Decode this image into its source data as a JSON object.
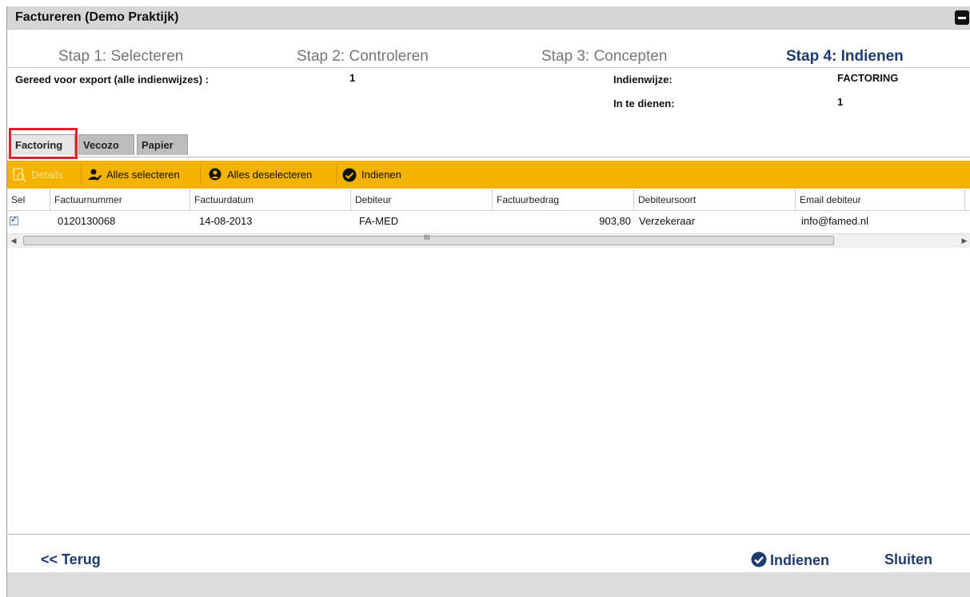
{
  "window": {
    "title": "Factureren (Demo Praktijk)",
    "minimize_icon": "minimize-icon"
  },
  "steps": [
    {
      "label": "Stap 1: Selecteren",
      "active": false
    },
    {
      "label": "Stap 2: Controleren",
      "active": false
    },
    {
      "label": "Stap 3: Concepten",
      "active": false
    },
    {
      "label": "Stap 4: Indienen",
      "active": true
    }
  ],
  "info": {
    "ready_label": "Gereed voor export (alle indienwijzes) :",
    "ready_value": "1",
    "method_label": "Indienwijze:",
    "method_value": "FACTORING",
    "to_submit_label": "In te dienen:",
    "to_submit_value": "1"
  },
  "tabs": [
    {
      "label": "Factoring",
      "active": true
    },
    {
      "label": "Vecozo",
      "active": false
    },
    {
      "label": "Papier",
      "active": false
    }
  ],
  "toolbar": {
    "details_label": "Details",
    "select_all_label": "Alles selecteren",
    "deselect_all_label": "Alles deselecteren",
    "submit_label": "Indienen"
  },
  "table": {
    "columns": [
      "Sel",
      "Factuurnummer",
      "Factuurdatum",
      "Debiteur",
      "Factuurbedrag",
      "Debiteursoort",
      "Email debiteur"
    ],
    "rows": [
      {
        "selected": true,
        "factuurnummer": "0120130068",
        "factuurdatum": "14-08-2013",
        "debiteur": "FA-MED",
        "factuurbedrag": "903,80",
        "debiteursoort": "Verzekeraar",
        "email": "info@famed.nl"
      }
    ]
  },
  "scrollbar": {
    "left_arrow": "◀",
    "right_arrow": "▶",
    "grip": "III"
  },
  "footer": {
    "back_label": "<< Terug",
    "submit_label": "Indienen",
    "close_label": "Sluiten"
  },
  "colors": {
    "accent": "#f5b301",
    "title_blue": "#1f3b6e",
    "highlight": "#e0202a"
  }
}
